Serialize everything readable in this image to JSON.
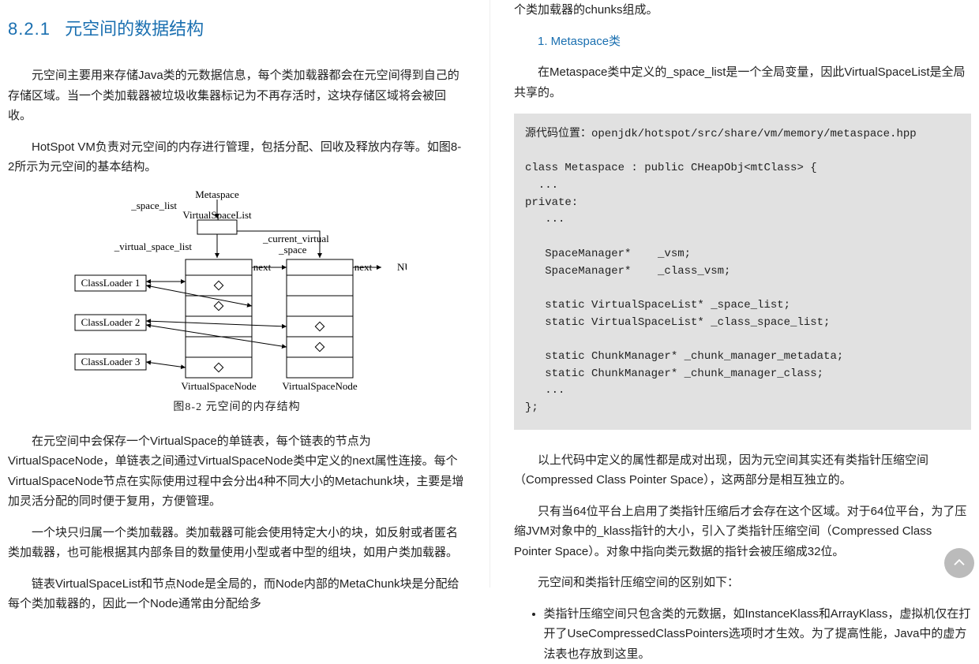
{
  "left": {
    "section_number": "8.2.1",
    "section_title": "元空间的数据结构",
    "p1": "元空间主要用来存储Java类的元数据信息，每个类加载器都会在元空间得到自己的存储区域。当一个类加载器被垃圾收集器标记为不再存活时，这块存储区域将会被回收。",
    "p2": "HotSpot VM负责对元空间的内存进行管理，包括分配、回收及释放内存等。如图8-2所示为元空间的基本结构。",
    "figure": {
      "label_metaspace": "Metaspace",
      "label_space_list": "_space_list",
      "label_virtual_space_list_top": "VirtualSpaceList",
      "label_virtual_space_list_left": "_virtual_space_list",
      "label_current_virtual_space": "_current_virtual\n_space",
      "label_next1": "next",
      "label_next2": "next",
      "label_null": "NULL",
      "label_classloader1": "ClassLoader 1",
      "label_classloader2": "ClassLoader 2",
      "label_classloader3": "ClassLoader 3",
      "label_vsn1": "VirtualSpaceNode",
      "label_vsn2": "VirtualSpaceNode",
      "caption": "图8-2  元空间的内存结构"
    },
    "p3": "在元空间中会保存一个VirtualSpace的单链表，每个链表的节点为VirtualSpaceNode，单链表之间通过VirtualSpaceNode类中定义的next属性连接。每个VirtualSpaceNode节点在实际使用过程中会分出4种不同大小的Metachunk块，主要是增加灵活分配的同时便于复用，方便管理。",
    "p4": "一个块只归属一个类加载器。类加载器可能会使用特定大小的块，如反射或者匿名类加载器，也可能根据其内部条目的数量使用小型或者中型的组块，如用户类加载器。",
    "p5": "链表VirtualSpaceList和节点Node是全局的，而Node内部的MetaChunk块是分配给每个类加载器的，因此一个Node通常由分配给多"
  },
  "right": {
    "p_continuation": "个类加载器的chunks组成。",
    "sub_heading": "1.  Metaspace类",
    "p6": "在Metaspace类中定义的_space_list是一个全局变量，因此VirtualSpaceList是全局共享的。",
    "code_location_label": "源代码位置：",
    "code_location_path": "openjdk/hotspot/src/share/vm/memory/metaspace.hpp",
    "code_body": "class Metaspace : public CHeapObj<mtClass> {\n  ...\nprivate:\n   ...\n\n   SpaceManager*    _vsm;\n   SpaceManager*    _class_vsm;\n\n   static VirtualSpaceList* _space_list;\n   static VirtualSpaceList* _class_space_list;\n\n   static ChunkManager* _chunk_manager_metadata;\n   static ChunkManager* _chunk_manager_class;\n   ...\n};",
    "p7": "以上代码中定义的属性都是成对出现，因为元空间其实还有类指针压缩空间（Compressed Class Pointer Space），这两部分是相互独立的。",
    "p8": "只有当64位平台上启用了类指针压缩后才会存在这个区域。对于64位平台，为了压缩JVM对象中的_klass指针的大小，引入了类指针压缩空间（Compressed Class Pointer Space）。对象中指向类元数据的指针会被压缩成32位。",
    "p9": "元空间和类指针压缩空间的区别如下：",
    "bullet1": "类指针压缩空间只包含类的元数据，如InstanceKlass和ArrayKlass，虚拟机仅在打开了UseCompressedClassPointers选项时才生效。为了提高性能，Java中的虚方法表也存放到这里。"
  }
}
